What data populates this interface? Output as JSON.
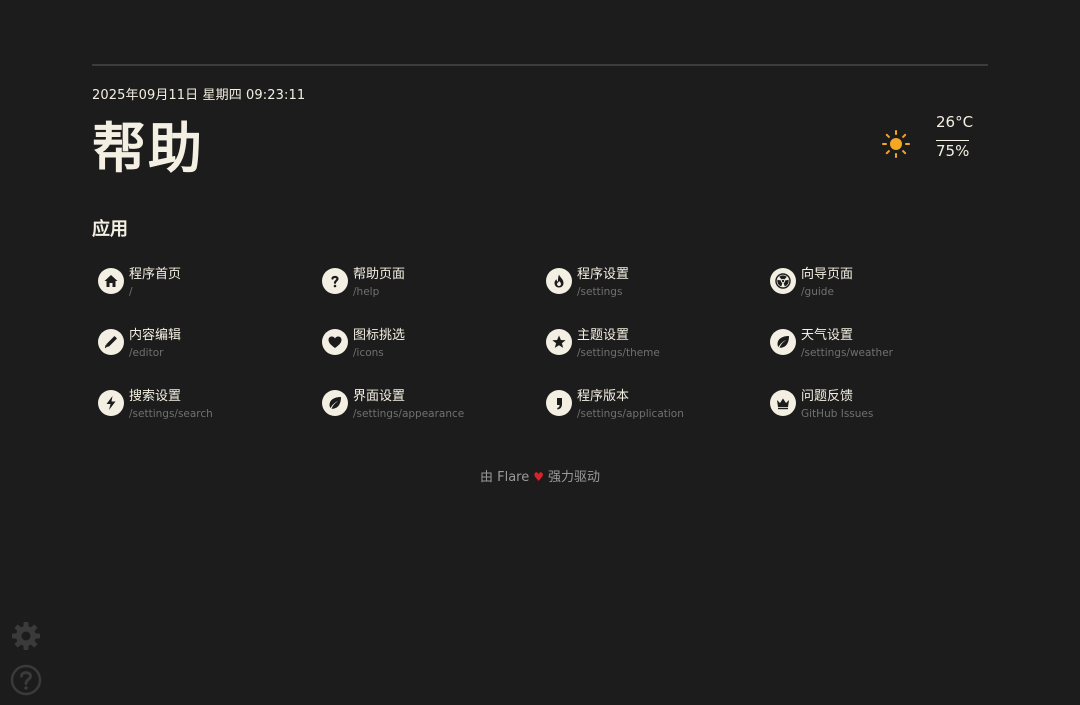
{
  "header": {
    "datetime": "2025年09月11日 星期四 09:23:11",
    "title": "帮助"
  },
  "weather": {
    "icon": "sun-icon",
    "temperature": "26°C",
    "humidity": "75%",
    "sun_color": "#f5a623"
  },
  "apps": {
    "heading": "应用",
    "items": [
      {
        "name": "程序首页",
        "url": "/",
        "icon": "home-icon"
      },
      {
        "name": "帮助页面",
        "url": "/help",
        "icon": "question-icon"
      },
      {
        "name": "程序设置",
        "url": "/settings",
        "icon": "fire-icon"
      },
      {
        "name": "向导页面",
        "url": "/guide",
        "icon": "radiation-icon"
      },
      {
        "name": "内容编辑",
        "url": "/editor",
        "icon": "pencil-icon"
      },
      {
        "name": "图标挑选",
        "url": "/icons",
        "icon": "heart-icon"
      },
      {
        "name": "主题设置",
        "url": "/settings/theme",
        "icon": "star-icon"
      },
      {
        "name": "天气设置",
        "url": "/settings/weather",
        "icon": "leaf-icon"
      },
      {
        "name": "搜索设置",
        "url": "/settings/search",
        "icon": "lightning-icon"
      },
      {
        "name": "界面设置",
        "url": "/settings/appearance",
        "icon": "leaf-icon"
      },
      {
        "name": "程序版本",
        "url": "/settings/application",
        "icon": "comma-icon"
      },
      {
        "name": "问题反馈",
        "url": "GitHub Issues",
        "icon": "crown-icon"
      }
    ]
  },
  "footer": {
    "prefix": "由 Flare",
    "suffix": "强力驱动",
    "heart_icon": "heart-icon",
    "heart_color": "#d8232a"
  },
  "corner": {
    "settings_icon": "gear-icon",
    "help_icon": "question-circle-icon"
  },
  "colors": {
    "background": "#1c1c1c",
    "foreground": "#f3efe2",
    "muted": "#707070"
  }
}
